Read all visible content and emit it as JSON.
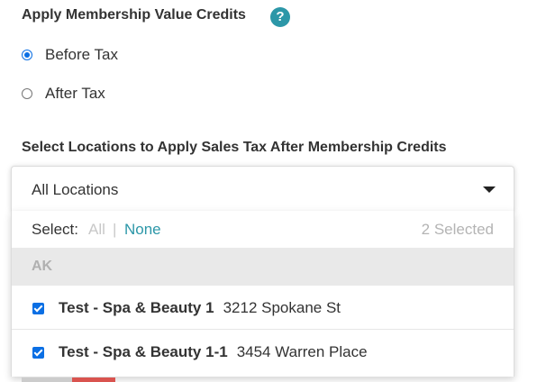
{
  "membership_credits": {
    "heading": "Apply Membership Value Credits",
    "help_icon_glyph": "?",
    "help_icon_color": "#2c97a8",
    "options": [
      {
        "label": "Before Tax",
        "checked": true
      },
      {
        "label": "After Tax",
        "checked": false
      }
    ]
  },
  "locations": {
    "heading": "Select Locations to Apply Sales Tax After Membership Credits",
    "dropdown": {
      "value": "All Locations",
      "caret_icon": "caret-down-icon"
    },
    "menu": {
      "select_label": "Select:",
      "all_label": "All",
      "separator": "|",
      "none_label": "None",
      "selected_count": "2 Selected",
      "group": "AK",
      "items": [
        {
          "name": "Test - Spa & Beauty 1",
          "address": "3212 Spokane St",
          "checked": true
        },
        {
          "name": "Test - Spa & Beauty 1-1",
          "address": "3454 Warren Place",
          "checked": true
        }
      ]
    }
  },
  "colors": {
    "accent": "#2c97a8",
    "checkbox": "#0b6fe4",
    "group_header_bg": "#e9e9e9"
  }
}
